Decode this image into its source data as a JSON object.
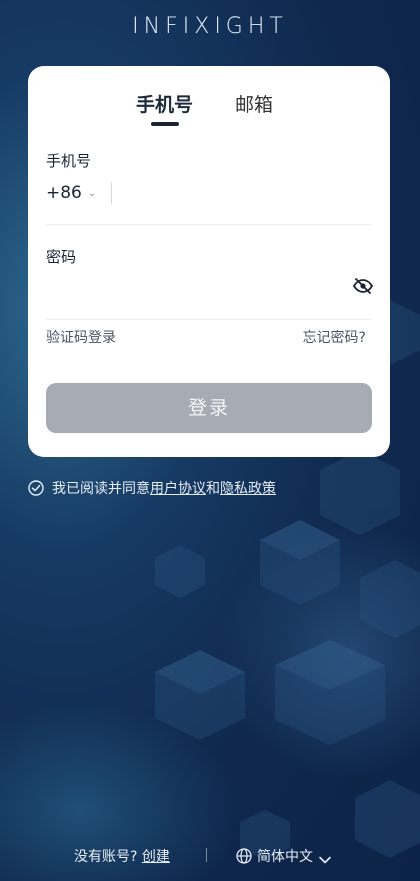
{
  "brand": {
    "logo_text": "INFIXIGHT"
  },
  "tabs": [
    {
      "label": "手机号",
      "active": true
    },
    {
      "label": "邮箱",
      "active": false
    }
  ],
  "phone": {
    "label": "手机号",
    "country_code": "+86",
    "value": "",
    "placeholder": ""
  },
  "password": {
    "label": "密码",
    "value": "",
    "placeholder": ""
  },
  "links": {
    "sms_login": "验证码登录",
    "forgot": "忘记密码?"
  },
  "login_button": "登录",
  "agreement": {
    "prefix": "我已阅读并同意",
    "terms": "用户协议",
    "and": "和",
    "privacy": "隐私政策",
    "checked": true
  },
  "footer": {
    "no_account": "没有账号?",
    "create": "创建",
    "language": "简体中文"
  },
  "colors": {
    "background": "#10294f",
    "card": "#ffffff",
    "button_disabled": "#a7abb3",
    "text_dark": "#1b2433"
  },
  "icons": [
    "eye-off-icon",
    "check-circle-icon",
    "globe-icon",
    "chevron-down-icon"
  ]
}
